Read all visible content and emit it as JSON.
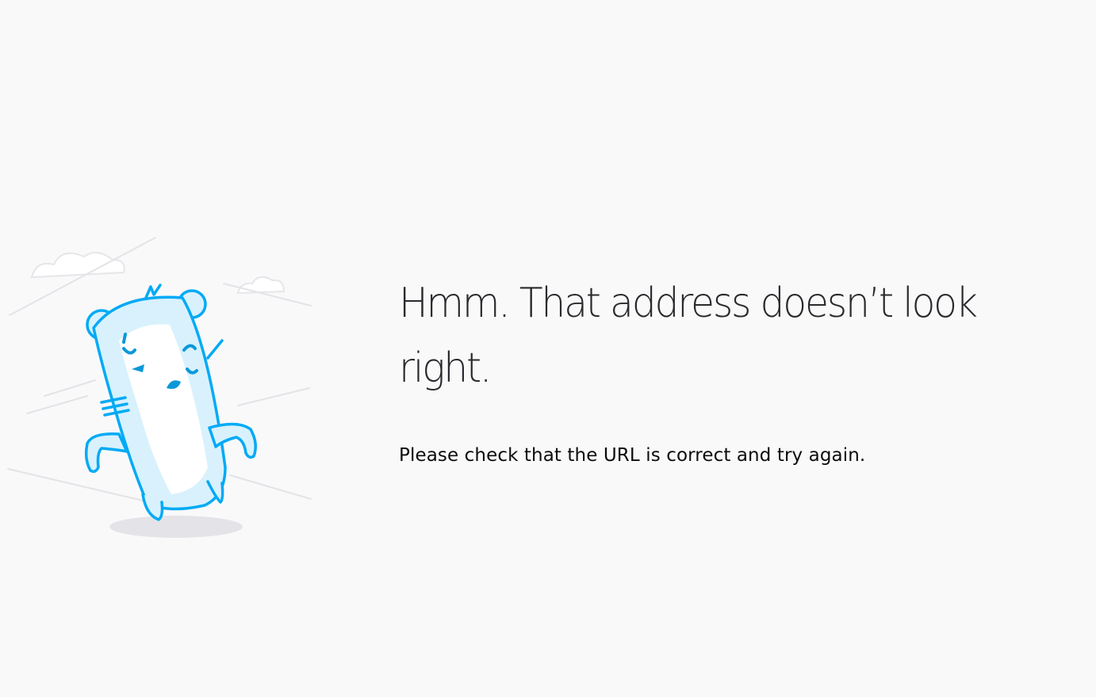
{
  "error": {
    "title": "Hmm. That address doesn’t look right.",
    "description": "Please check that the URL is correct and try again."
  },
  "colors": {
    "background": "#f9f9fa",
    "title": "#2a2a2e",
    "description": "#0c0c0d",
    "illustration_stroke": "#00aaf5",
    "illustration_fill": "#d8f1fd"
  },
  "icons": {
    "illustration": "sad-robot-illustration-icon"
  }
}
